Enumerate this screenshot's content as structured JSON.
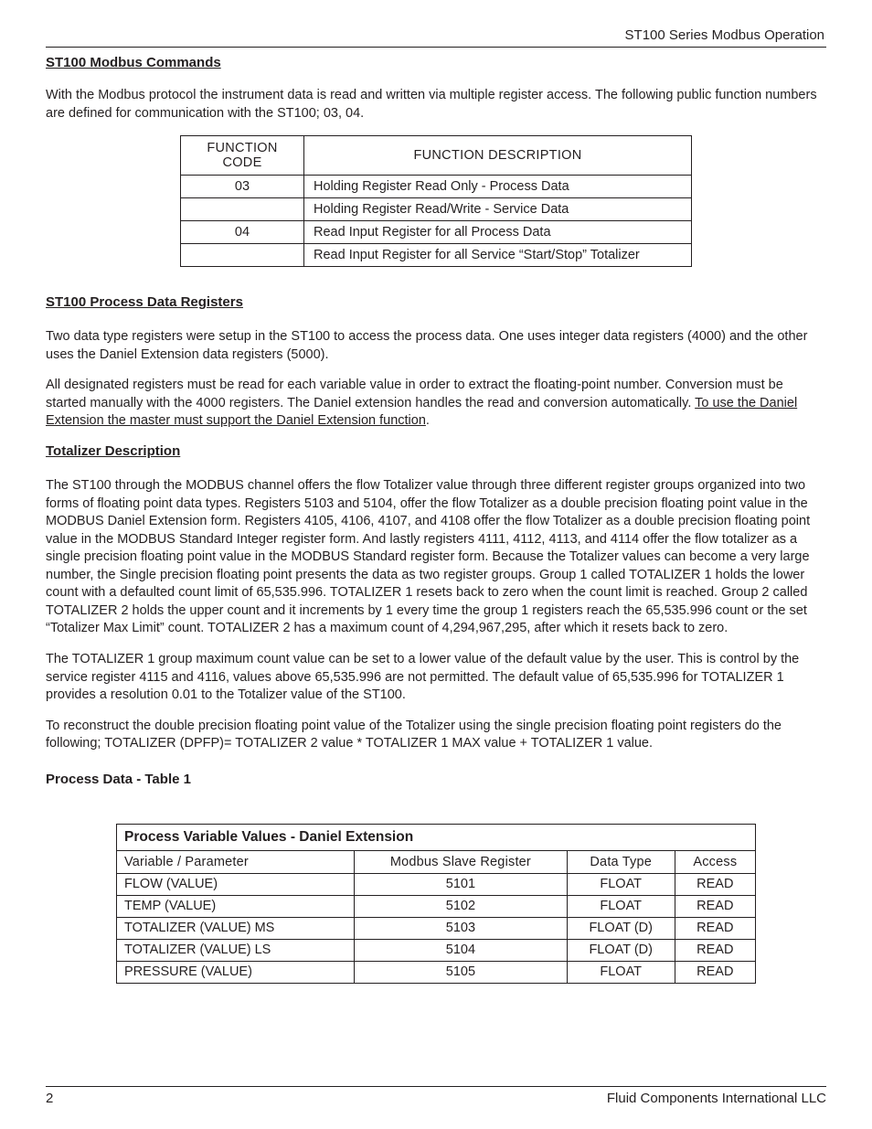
{
  "header": {
    "running": "ST100 Series Modbus Operation"
  },
  "section1": {
    "heading": "ST100 Modbus Commands",
    "para1": "With the Modbus protocol the instrument data is read and written via multiple register access. The following public function numbers are defined for communication with the ST100; 03, 04."
  },
  "functionTable": {
    "head_code": "FUNCTION CODE",
    "head_desc": "FUNCTION DESCRIPTION",
    "rows": [
      {
        "code": "03",
        "desc": "Holding Register Read Only - Process Data"
      },
      {
        "code": "",
        "desc": "Holding Register Read/Write - Service Data"
      },
      {
        "code": "04",
        "desc": "Read Input Register for all Process Data"
      },
      {
        "code": "",
        "desc": "Read Input Register for all Service “Start/Stop” Totalizer"
      }
    ]
  },
  "section2": {
    "heading": "ST100 Process Data Registers",
    "para1": "Two data type registers were setup in the ST100 to access the process data. One uses integer data registers (4000) and the other uses the Daniel Extension data registers (5000).",
    "para2a": "All designated registers must be read for each variable value in order to extract the floating-point number. Conversion must be started manually with the 4000 registers. The Daniel extension handles the read and conversion automatically. ",
    "para2b": "To use the Daniel Extension the master must support the Daniel Extension function",
    "para2c": "."
  },
  "section3": {
    "heading": "Totalizer Description",
    "para1": "The ST100 through the MODBUS channel offers the flow Totalizer value through three different register groups organized into two forms of floating point data types. Registers 5103 and 5104, offer the flow Totalizer as a double precision floating point value in the MODBUS Daniel Extension form. Registers 4105, 4106, 4107, and 4108 offer the flow Totalizer as a double precision floating point value in the MODBUS Standard Integer register form. And lastly registers 4111, 4112, 4113, and 4114 offer the flow totalizer as a single precision floating point value in the MODBUS Standard register form. Because the Totalizer values can become a very large number, the Single precision floating point presents the data as two register groups. Group 1 called TOTALIZER 1 holds the lower count with a defaulted count limit of 65,535.996. TOTALIZER 1 resets back to zero when the count limit is reached. Group 2 called TOTALIZER 2 holds the upper count and it increments by 1 every time the group 1 registers reach the 65,535.996 count or the set “Totalizer Max Limit” count. TOTALIZER 2 has a maximum count of 4,294,967,295, after which it resets back to zero.",
    "para2": "The TOTALIZER 1 group maximum count value can be set to a lower value of the default value by the user. This is control by the service register 4115 and 4116, values above 65,535.996 are not permitted. The default value of 65,535.996 for TOTALIZER 1 provides a resolution 0.01 to the Totalizer value of the ST100.",
    "para3": "To reconstruct the double precision floating point value of the Totalizer using the single precision floating point registers do the following; TOTALIZER (DPFP)= TOTALIZER 2  value * TOTALIZER 1 MAX value + TOTALIZER 1 value."
  },
  "processDataTitle": "Process Data - Table 1",
  "processTable": {
    "title": "Process Variable Values - Daniel Extension",
    "head_var": "Variable / Parameter",
    "head_reg": "Modbus Slave Register",
    "head_type": "Data Type",
    "head_access": "Access",
    "rows": [
      {
        "var": "FLOW (VALUE)",
        "reg": "5101",
        "type": "FLOAT",
        "access": "READ"
      },
      {
        "var": "TEMP (VALUE)",
        "reg": "5102",
        "type": "FLOAT",
        "access": "READ"
      },
      {
        "var": "TOTALIZER (VALUE) MS",
        "reg": "5103",
        "type": "FLOAT (D)",
        "access": "READ"
      },
      {
        "var": "TOTALIZER (VALUE) LS",
        "reg": "5104",
        "type": "FLOAT (D)",
        "access": "READ"
      },
      {
        "var": "PRESSURE (VALUE)",
        "reg": "5105",
        "type": "FLOAT",
        "access": "READ"
      }
    ]
  },
  "footer": {
    "page": "2",
    "company": "Fluid Components International LLC"
  }
}
